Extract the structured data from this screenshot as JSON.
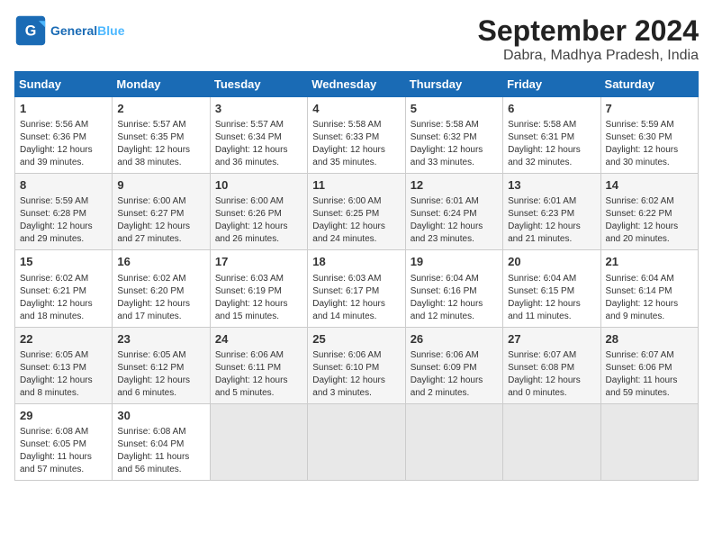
{
  "header": {
    "logo_text_general": "General",
    "logo_text_blue": "Blue",
    "title": "September 2024",
    "subtitle": "Dabra, Madhya Pradesh, India"
  },
  "calendar": {
    "days_of_week": [
      "Sunday",
      "Monday",
      "Tuesday",
      "Wednesday",
      "Thursday",
      "Friday",
      "Saturday"
    ],
    "weeks": [
      [
        {
          "day": "1",
          "info": "Sunrise: 5:56 AM\nSunset: 6:36 PM\nDaylight: 12 hours\nand 39 minutes."
        },
        {
          "day": "2",
          "info": "Sunrise: 5:57 AM\nSunset: 6:35 PM\nDaylight: 12 hours\nand 38 minutes."
        },
        {
          "day": "3",
          "info": "Sunrise: 5:57 AM\nSunset: 6:34 PM\nDaylight: 12 hours\nand 36 minutes."
        },
        {
          "day": "4",
          "info": "Sunrise: 5:58 AM\nSunset: 6:33 PM\nDaylight: 12 hours\nand 35 minutes."
        },
        {
          "day": "5",
          "info": "Sunrise: 5:58 AM\nSunset: 6:32 PM\nDaylight: 12 hours\nand 33 minutes."
        },
        {
          "day": "6",
          "info": "Sunrise: 5:58 AM\nSunset: 6:31 PM\nDaylight: 12 hours\nand 32 minutes."
        },
        {
          "day": "7",
          "info": "Sunrise: 5:59 AM\nSunset: 6:30 PM\nDaylight: 12 hours\nand 30 minutes."
        }
      ],
      [
        {
          "day": "8",
          "info": "Sunrise: 5:59 AM\nSunset: 6:28 PM\nDaylight: 12 hours\nand 29 minutes."
        },
        {
          "day": "9",
          "info": "Sunrise: 6:00 AM\nSunset: 6:27 PM\nDaylight: 12 hours\nand 27 minutes."
        },
        {
          "day": "10",
          "info": "Sunrise: 6:00 AM\nSunset: 6:26 PM\nDaylight: 12 hours\nand 26 minutes."
        },
        {
          "day": "11",
          "info": "Sunrise: 6:00 AM\nSunset: 6:25 PM\nDaylight: 12 hours\nand 24 minutes."
        },
        {
          "day": "12",
          "info": "Sunrise: 6:01 AM\nSunset: 6:24 PM\nDaylight: 12 hours\nand 23 minutes."
        },
        {
          "day": "13",
          "info": "Sunrise: 6:01 AM\nSunset: 6:23 PM\nDaylight: 12 hours\nand 21 minutes."
        },
        {
          "day": "14",
          "info": "Sunrise: 6:02 AM\nSunset: 6:22 PM\nDaylight: 12 hours\nand 20 minutes."
        }
      ],
      [
        {
          "day": "15",
          "info": "Sunrise: 6:02 AM\nSunset: 6:21 PM\nDaylight: 12 hours\nand 18 minutes."
        },
        {
          "day": "16",
          "info": "Sunrise: 6:02 AM\nSunset: 6:20 PM\nDaylight: 12 hours\nand 17 minutes."
        },
        {
          "day": "17",
          "info": "Sunrise: 6:03 AM\nSunset: 6:19 PM\nDaylight: 12 hours\nand 15 minutes."
        },
        {
          "day": "18",
          "info": "Sunrise: 6:03 AM\nSunset: 6:17 PM\nDaylight: 12 hours\nand 14 minutes."
        },
        {
          "day": "19",
          "info": "Sunrise: 6:04 AM\nSunset: 6:16 PM\nDaylight: 12 hours\nand 12 minutes."
        },
        {
          "day": "20",
          "info": "Sunrise: 6:04 AM\nSunset: 6:15 PM\nDaylight: 12 hours\nand 11 minutes."
        },
        {
          "day": "21",
          "info": "Sunrise: 6:04 AM\nSunset: 6:14 PM\nDaylight: 12 hours\nand 9 minutes."
        }
      ],
      [
        {
          "day": "22",
          "info": "Sunrise: 6:05 AM\nSunset: 6:13 PM\nDaylight: 12 hours\nand 8 minutes."
        },
        {
          "day": "23",
          "info": "Sunrise: 6:05 AM\nSunset: 6:12 PM\nDaylight: 12 hours\nand 6 minutes."
        },
        {
          "day": "24",
          "info": "Sunrise: 6:06 AM\nSunset: 6:11 PM\nDaylight: 12 hours\nand 5 minutes."
        },
        {
          "day": "25",
          "info": "Sunrise: 6:06 AM\nSunset: 6:10 PM\nDaylight: 12 hours\nand 3 minutes."
        },
        {
          "day": "26",
          "info": "Sunrise: 6:06 AM\nSunset: 6:09 PM\nDaylight: 12 hours\nand 2 minutes."
        },
        {
          "day": "27",
          "info": "Sunrise: 6:07 AM\nSunset: 6:08 PM\nDaylight: 12 hours\nand 0 minutes."
        },
        {
          "day": "28",
          "info": "Sunrise: 6:07 AM\nSunset: 6:06 PM\nDaylight: 11 hours\nand 59 minutes."
        }
      ],
      [
        {
          "day": "29",
          "info": "Sunrise: 6:08 AM\nSunset: 6:05 PM\nDaylight: 11 hours\nand 57 minutes."
        },
        {
          "day": "30",
          "info": "Sunrise: 6:08 AM\nSunset: 6:04 PM\nDaylight: 11 hours\nand 56 minutes."
        },
        {
          "day": "",
          "info": ""
        },
        {
          "day": "",
          "info": ""
        },
        {
          "day": "",
          "info": ""
        },
        {
          "day": "",
          "info": ""
        },
        {
          "day": "",
          "info": ""
        }
      ]
    ]
  }
}
